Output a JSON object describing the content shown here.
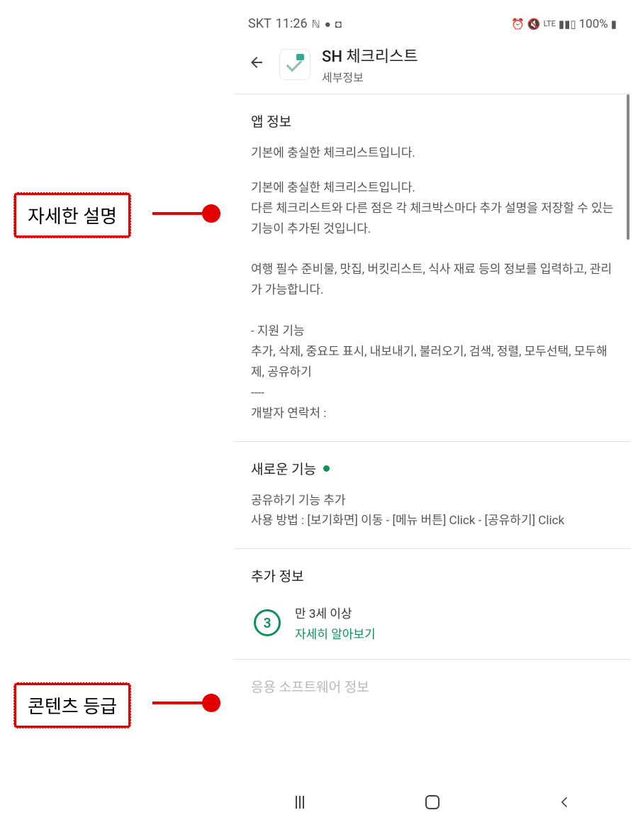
{
  "statusBar": {
    "carrier": "SKT",
    "time": "11:26",
    "batteryPercent": "100%",
    "networkLabel": "LTE"
  },
  "header": {
    "appName": "SH 체크리스트",
    "subtitle": "세부정보"
  },
  "sections": {
    "appInfo": {
      "title": "앱 정보",
      "summary": "기본에 충실한 체크리스트입니다.",
      "body": "기본에 충실한 체크리스트입니다.\n다른 체크리스트와 다른 점은 각 체크박스마다 추가 설명을 저장할 수 있는 기능이 추가된 것입니다.\n\n여행 필수 준비물, 맛집, 버킷리스트, 식사 재료 등의 정보를 입력하고, 관리가 가능합니다.\n\n- 지원 기능\n추가, 삭제, 중요도 표시, 내보내기, 불러오기, 검색, 정렬, 모두선택, 모두해제, 공유하기\n----\n개발자 연락처 :"
    },
    "whatsNew": {
      "title": "새로운 기능",
      "body": "공유하기 기능 추가\n사용 방법 : [보기화면] 이동 - [메뉴 버튼] Click - [공유하기] Click"
    },
    "additional": {
      "title": "추가 정보",
      "ratingNumber": "3",
      "ratingLabel": "만 3세 이상",
      "learnMore": "자세히 알아보기"
    },
    "fadedNext": "응용 소프트웨어 정보"
  },
  "annotations": {
    "description": "자세한 설명",
    "contentRating": "콘텐츠 등급"
  }
}
